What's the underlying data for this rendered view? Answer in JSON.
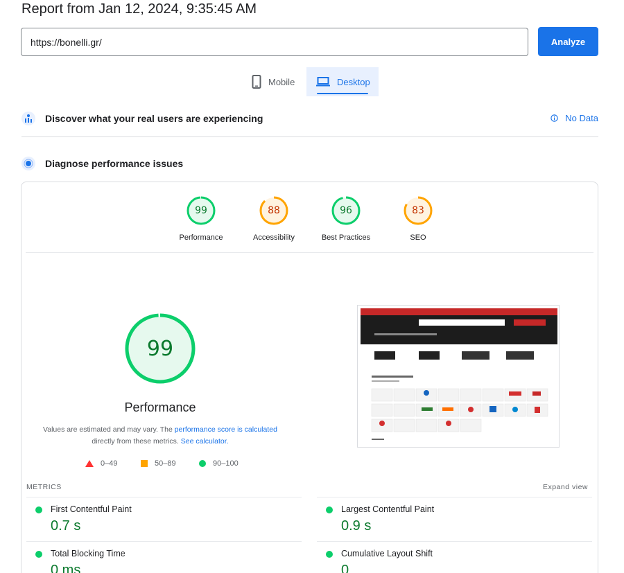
{
  "report": {
    "title": "Report from Jan 12, 2024, 9:35:45 AM"
  },
  "url_bar": {
    "value": "https://bonelli.gr/",
    "button_label": "Analyze"
  },
  "device_tabs": [
    {
      "label": "Mobile",
      "icon": "phone-icon",
      "selected": false
    },
    {
      "label": "Desktop",
      "icon": "laptop-icon",
      "selected": true
    }
  ],
  "field_data": {
    "title": "Discover what your real users are experiencing",
    "status": "No Data",
    "icon": "users-chart-icon"
  },
  "lab_data": {
    "title": "Diagnose performance issues",
    "icon": "diagnose-icon"
  },
  "categories": [
    {
      "label": "Performance",
      "score": 99,
      "color": "#0cce6b",
      "bg": "#e6f9ee",
      "text": "#0c7a2e"
    },
    {
      "label": "Accessibility",
      "score": 88,
      "color": "#ffa400",
      "bg": "#fff3e0",
      "text": "#c33300"
    },
    {
      "label": "Best Practices",
      "score": 96,
      "color": "#0cce6b",
      "bg": "#e6f9ee",
      "text": "#0c7a2e"
    },
    {
      "label": "SEO",
      "score": 83,
      "color": "#ffa400",
      "bg": "#fff3e0",
      "text": "#c33300"
    }
  ],
  "performance": {
    "score": 99,
    "title": "Performance",
    "disclaimer_pre": "Values are estimated and may vary. The ",
    "disclaimer_link1": "performance score is calculated",
    "disclaimer_mid": " directly from these metrics. ",
    "disclaimer_link2": "See calculator."
  },
  "legend": [
    {
      "range": "0–49",
      "shape": "triangle",
      "color": "#ff3333"
    },
    {
      "range": "50–89",
      "shape": "square",
      "color": "#ffa400"
    },
    {
      "range": "90–100",
      "shape": "circle",
      "color": "#0cce6b"
    }
  ],
  "metrics": {
    "label": "METRICS",
    "expand_label": "Expand view",
    "items": [
      {
        "name": "First Contentful Paint",
        "value": "0.7 s"
      },
      {
        "name": "Largest Contentful Paint",
        "value": "0.9 s"
      },
      {
        "name": "Total Blocking Time",
        "value": "0 ms"
      },
      {
        "name": "Cumulative Layout Shift",
        "value": "0"
      }
    ]
  },
  "colors": {
    "accent": "#1a73e8",
    "pass": "#0cce6b",
    "average": "#ffa400",
    "fail": "#ff3333"
  }
}
